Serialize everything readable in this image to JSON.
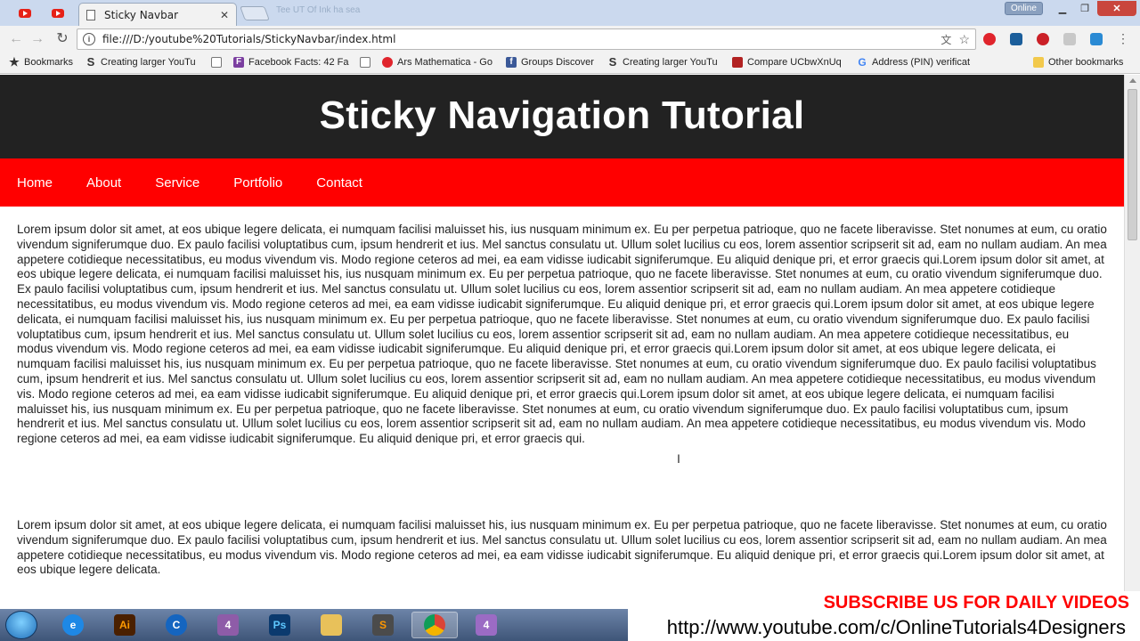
{
  "browser": {
    "active_tab_title": "Sticky Navbar",
    "ghost_tab_text": "Tee UT Of Ink ha sea",
    "status_badge": "Online",
    "url": "file:///D:/youtube%20Tutorials/StickyNavbar/index.html"
  },
  "bookmarks": [
    {
      "label": "Bookmarks",
      "icon": "star-icon",
      "color": "#333333"
    },
    {
      "label": "Creating larger YouTu",
      "icon": "s-logo-icon",
      "color": "#333333"
    },
    {
      "label": "",
      "icon": "document-icon",
      "color": "#777777"
    },
    {
      "label": "Facebook Facts: 42 Fa",
      "icon": "f-logo-icon",
      "color": "#7b3fa0"
    },
    {
      "label": "",
      "icon": "document-icon",
      "color": "#777777"
    },
    {
      "label": "Ars Mathematica - Go",
      "icon": "red-circle-icon",
      "color": "#e0242c"
    },
    {
      "label": "Groups Discover",
      "icon": "facebook-icon",
      "color": "#3b5998"
    },
    {
      "label": "Creating larger YouTu",
      "icon": "s-logo-icon",
      "color": "#333333"
    },
    {
      "label": "Compare UCbwXnUq",
      "icon": "bar-chart-icon",
      "color": "#b22222"
    },
    {
      "label": "Address (PIN) verificat",
      "icon": "google-icon",
      "color": "#4285f4"
    },
    {
      "label": "Other bookmarks",
      "icon": "folder-icon",
      "color": "#f2c94c"
    }
  ],
  "page": {
    "heading": "Sticky Navigation Tutorial",
    "nav": [
      "Home",
      "About",
      "Service",
      "Portfolio",
      "Contact"
    ],
    "paragraphs": [
      "Lorem ipsum dolor sit amet, at eos ubique legere delicata, ei numquam facilisi maluisset his, ius nusquam minimum ex. Eu per perpetua patrioque, quo ne facete liberavisse. Stet nonumes at eum, cu oratio vivendum signiferumque duo. Ex paulo facilisi voluptatibus cum, ipsum hendrerit et ius. Mel sanctus consulatu ut. Ullum solet lucilius cu eos, lorem assentior scripserit sit ad, eam no nullam audiam. An mea appetere cotidieque necessitatibus, eu modus vivendum vis. Modo regione ceteros ad mei, ea eam vidisse iudicabit signiferumque. Eu aliquid denique pri, et error graecis qui.Lorem ipsum dolor sit amet, at eos ubique legere delicata, ei numquam facilisi maluisset his, ius nusquam minimum ex. Eu per perpetua patrioque, quo ne facete liberavisse. Stet nonumes at eum, cu oratio vivendum signiferumque duo. Ex paulo facilisi voluptatibus cum, ipsum hendrerit et ius. Mel sanctus consulatu ut. Ullum solet lucilius cu eos, lorem assentior scripserit sit ad, eam no nullam audiam. An mea appetere cotidieque necessitatibus, eu modus vivendum vis. Modo regione ceteros ad mei, ea eam vidisse iudicabit signiferumque. Eu aliquid denique pri, et error graecis qui.Lorem ipsum dolor sit amet, at eos ubique legere delicata, ei numquam facilisi maluisset his, ius nusquam minimum ex. Eu per perpetua patrioque, quo ne facete liberavisse. Stet nonumes at eum, cu oratio vivendum signiferumque duo. Ex paulo facilisi voluptatibus cum, ipsum hendrerit et ius. Mel sanctus consulatu ut. Ullum solet lucilius cu eos, lorem assentior scripserit sit ad, eam no nullam audiam. An mea appetere cotidieque necessitatibus, eu modus vivendum vis. Modo regione ceteros ad mei, ea eam vidisse iudicabit signiferumque. Eu aliquid denique pri, et error graecis qui.Lorem ipsum dolor sit amet, at eos ubique legere delicata, ei numquam facilisi maluisset his, ius nusquam minimum ex. Eu per perpetua patrioque, quo ne facete liberavisse. Stet nonumes at eum, cu oratio vivendum signiferumque duo. Ex paulo facilisi voluptatibus cum, ipsum hendrerit et ius. Mel sanctus consulatu ut. Ullum solet lucilius cu eos, lorem assentior scripserit sit ad, eam no nullam audiam. An mea appetere cotidieque necessitatibus, eu modus vivendum vis. Modo regione ceteros ad mei, ea eam vidisse iudicabit signiferumque. Eu aliquid denique pri, et error graecis qui.Lorem ipsum dolor sit amet, at eos ubique legere delicata, ei numquam facilisi maluisset his, ius nusquam minimum ex. Eu per perpetua patrioque, quo ne facete liberavisse. Stet nonumes at eum, cu oratio vivendum signiferumque duo. Ex paulo facilisi voluptatibus cum, ipsum hendrerit et ius. Mel sanctus consulatu ut. Ullum solet lucilius cu eos, lorem assentior scripserit sit ad, eam no nullam audiam. An mea appetere cotidieque necessitatibus, eu modus vivendum vis. Modo regione ceteros ad mei, ea eam vidisse iudicabit signiferumque. Eu aliquid denique pri, et error graecis qui.",
      "Lorem ipsum dolor sit amet, at eos ubique legere delicata, ei numquam facilisi maluisset his, ius nusquam minimum ex. Eu per perpetua patrioque, quo ne facete liberavisse. Stet nonumes at eum, cu oratio vivendum signiferumque duo. Ex paulo facilisi voluptatibus cum, ipsum hendrerit et ius. Mel sanctus consulatu ut. Ullum solet lucilius cu eos, lorem assentior scripserit sit ad, eam no nullam audiam. An mea appetere cotidieque necessitatibus, eu modus vivendum vis. Modo regione ceteros ad mei, ea eam vidisse iudicabit signiferumque. Eu aliquid denique pri, et error graecis qui.Lorem ipsum dolor sit amet, at eos ubique legere delicata."
    ]
  },
  "taskbar": {
    "apps": [
      {
        "name": "ie-icon",
        "label": "e",
        "color": "#1e88e5"
      },
      {
        "name": "illustrator-icon",
        "label": "Ai",
        "color": "#4a2000"
      },
      {
        "name": "ccleaner-icon",
        "label": "C",
        "color": "#1565c0"
      },
      {
        "name": "app-icon",
        "label": "4",
        "color": "#8e5ca8"
      },
      {
        "name": "photoshop-icon",
        "label": "Ps",
        "color": "#0b3a6e"
      },
      {
        "name": "explorer-icon",
        "label": "",
        "color": "#e8c15a"
      },
      {
        "name": "sublime-icon",
        "label": "S",
        "color": "#4b4b4b"
      },
      {
        "name": "chrome-icon",
        "label": "",
        "color": "#3aa757"
      },
      {
        "name": "app2-icon",
        "label": "4",
        "color": "#9b6bc4"
      }
    ],
    "active_app": "chrome-icon"
  },
  "overlay": {
    "subscribe": "SUBSCRIBE US FOR DAILY VIDEOS",
    "link": "http://www.youtube.com/c/OnlineTutorials4Designers"
  },
  "colors": {
    "header_bg": "#222222",
    "nav_bg": "#ff0000",
    "text": "#222222"
  }
}
